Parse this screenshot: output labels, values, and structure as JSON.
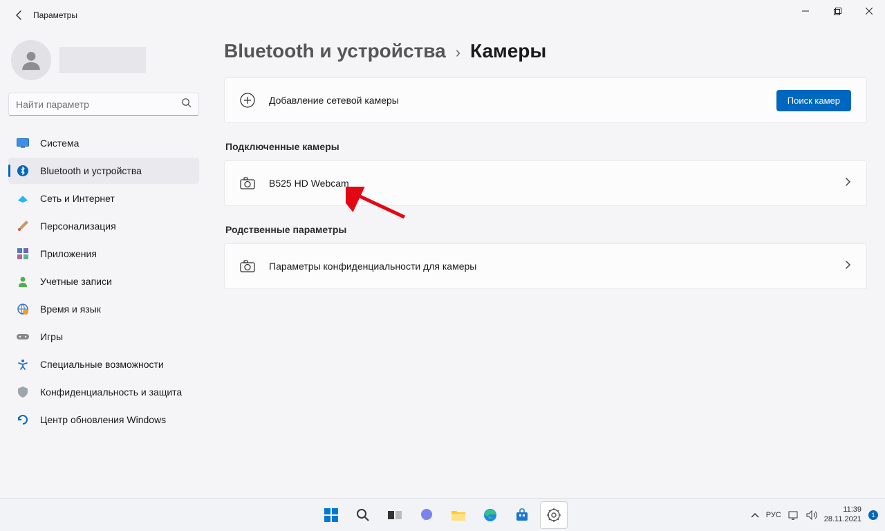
{
  "window": {
    "title": "Параметры"
  },
  "search": {
    "placeholder": "Найти параметр"
  },
  "user": {
    "name": ""
  },
  "sidebar": {
    "items": [
      {
        "label": "Система",
        "icon": "display"
      },
      {
        "label": "Bluetooth и устройства",
        "icon": "bluetooth",
        "active": true
      },
      {
        "label": "Сеть и Интернет",
        "icon": "wifi"
      },
      {
        "label": "Персонализация",
        "icon": "brush"
      },
      {
        "label": "Приложения",
        "icon": "apps"
      },
      {
        "label": "Учетные записи",
        "icon": "person"
      },
      {
        "label": "Время и язык",
        "icon": "globe"
      },
      {
        "label": "Игры",
        "icon": "gamepad"
      },
      {
        "label": "Специальные возможности",
        "icon": "accessibility"
      },
      {
        "label": "Конфиденциальность и защита",
        "icon": "shield"
      },
      {
        "label": "Центр обновления Windows",
        "icon": "update"
      }
    ]
  },
  "breadcrumb": {
    "parent": "Bluetooth и устройства",
    "current": "Камеры"
  },
  "add_camera": {
    "label": "Добавление сетевой камеры",
    "button": "Поиск камер"
  },
  "sections": {
    "connected": {
      "title": "Подключенные камеры"
    },
    "related": {
      "title": "Родственные параметры"
    }
  },
  "connected_cameras": [
    {
      "name": "B525 HD Webcam"
    }
  ],
  "related_settings": [
    {
      "name": "Параметры конфиденциальности для камеры"
    }
  ],
  "taskbar": {
    "lang": "РУС",
    "time": "11:39",
    "date": "28.11.2021",
    "notif_count": "1"
  }
}
